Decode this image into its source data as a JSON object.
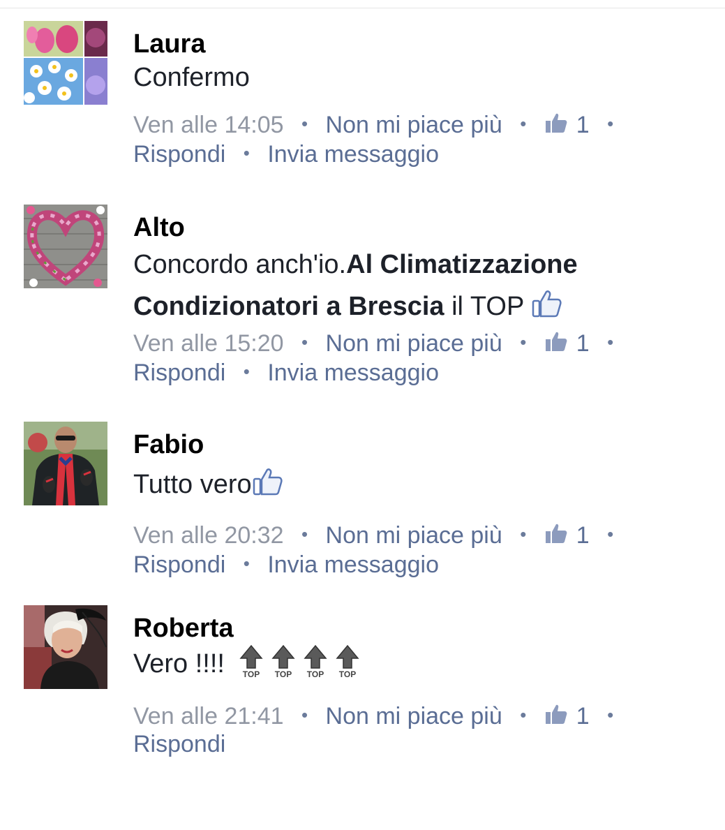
{
  "comments": [
    {
      "name": "Laura",
      "text": "Confermo",
      "time": "Ven alle 14:05",
      "unlike": "Non mi piace più",
      "likes": "1",
      "reply": "Rispondi",
      "message": "Invia messaggio",
      "avatar": "flowers-collage"
    },
    {
      "name": "Alto",
      "text_plain": "Concordo anch'io.",
      "text_bold": "Al Climatizzazione Condizionatori a Brescia",
      "text_tail": " il TOP",
      "time": "Ven alle 15:20",
      "unlike": "Non mi piace più",
      "likes": "1",
      "reply": "Rispondi",
      "message": "Invia messaggio",
      "avatar": "tulip-heart"
    },
    {
      "name": "Fabio",
      "text": "Tutto vero",
      "time": "Ven alle 20:32",
      "unlike": "Non mi piace più",
      "likes": "1",
      "reply": "Rispondi",
      "message": "Invia messaggio",
      "avatar": "man-with-scarf"
    },
    {
      "name": "Roberta",
      "text": "Vero !!!!",
      "top_label": "TOP",
      "time": "Ven alle 21:41",
      "unlike": "Non mi piace più",
      "likes": "1",
      "reply": "Rispondi",
      "avatar": "woman-with-hat"
    }
  ],
  "colors": {
    "link": "#5a6d94",
    "time": "#9197a3",
    "text": "#1d2129"
  }
}
